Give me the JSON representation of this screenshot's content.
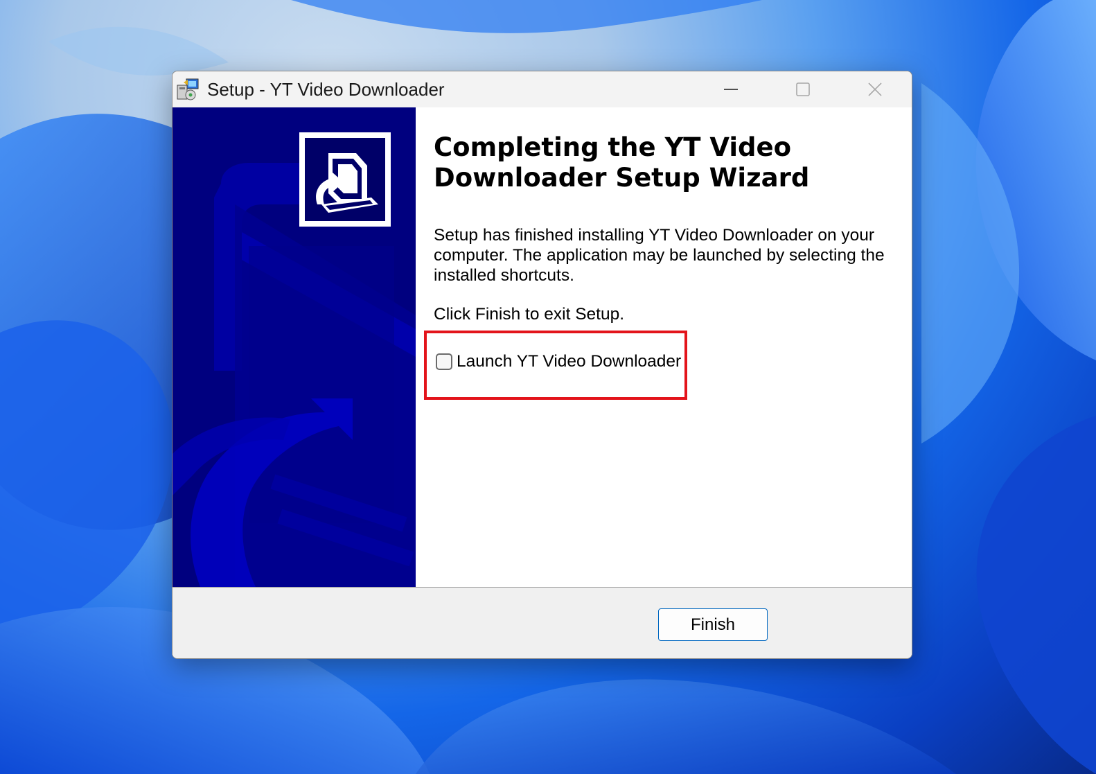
{
  "window": {
    "title": "Setup - YT Video Downloader",
    "controls": {
      "minimize_icon": "minimize-icon",
      "maximize_icon": "maximize-icon",
      "close_icon": "close-icon"
    }
  },
  "banner": {
    "logo_icon": "installer-computer-icon"
  },
  "content": {
    "heading": "Completing the YT Video Downloader Setup Wizard",
    "paragraph1": "Setup has finished installing YT Video Downloader on your computer. The application may be launched by selecting the installed shortcuts.",
    "paragraph2": "Click Finish to exit Setup.",
    "launch_checkbox": {
      "label": "Launch YT Video Downloader",
      "checked": false
    }
  },
  "footer": {
    "finish_label": "Finish"
  },
  "colors": {
    "banner_background": "#00007f",
    "highlight_border": "#e3141b",
    "button_border": "#0067c0",
    "footer_background": "#f0f0f0"
  }
}
